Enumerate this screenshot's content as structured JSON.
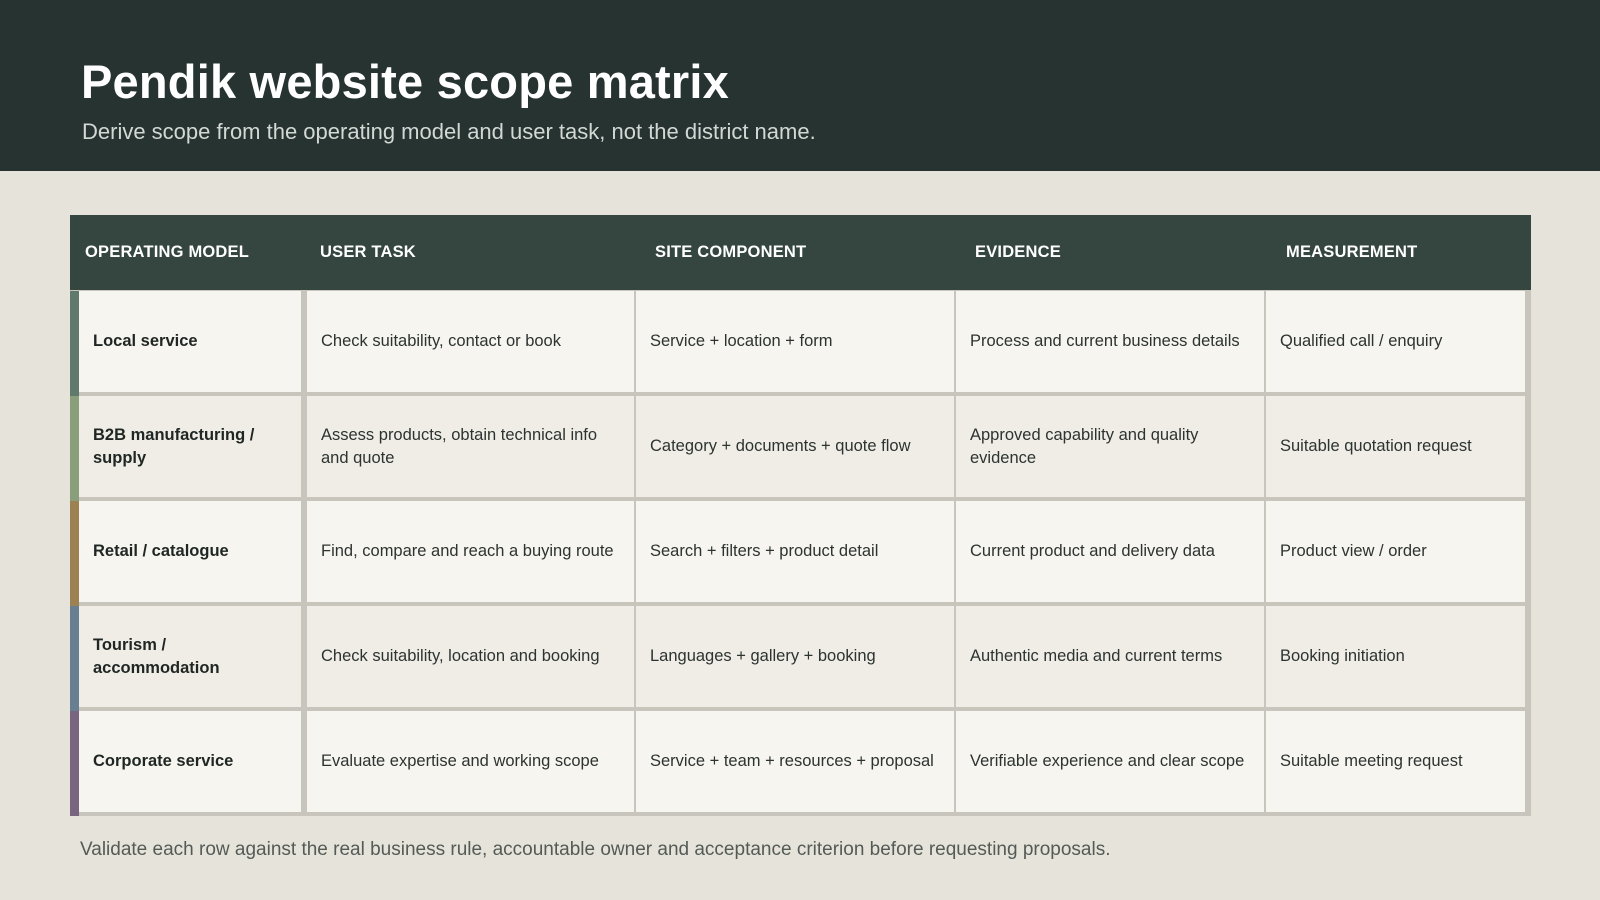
{
  "header": {
    "title": "Pendik website scope matrix",
    "subtitle": "Derive scope from the operating model and user task, not the district name."
  },
  "table": {
    "columns": [
      "OPERATING MODEL",
      "USER TASK",
      "SITE COMPONENT",
      "EVIDENCE",
      "MEASUREMENT"
    ],
    "rows": [
      {
        "accent_color": "#5f7a6c",
        "cells": [
          "Local service",
          "Check suitability, contact or book",
          "Service + location + form",
          "Process and current business details",
          "Qualified call / enquiry"
        ]
      },
      {
        "accent_color": "#8a9e7c",
        "cells": [
          "B2B manufacturing / supply",
          "Assess products, obtain technical info and quote",
          "Category + documents + quote flow",
          "Approved capability and quality evidence",
          "Suitable quotation request"
        ]
      },
      {
        "accent_color": "#9c8152",
        "cells": [
          "Retail / catalogue",
          "Find, compare and reach a buying route",
          "Search + filters + product detail",
          "Current product and delivery data",
          "Product view / order"
        ]
      },
      {
        "accent_color": "#687f92",
        "cells": [
          "Tourism / accommodation",
          "Check suitability, location and booking",
          "Languages + gallery + booking",
          "Authentic media and current terms",
          "Booking initiation"
        ]
      },
      {
        "accent_color": "#7a6580",
        "cells": [
          "Corporate service",
          "Evaluate expertise and working scope",
          "Service + team + resources + proposal",
          "Verifiable experience and clear scope",
          "Suitable meeting request"
        ]
      }
    ]
  },
  "footer": {
    "note": "Validate each row against the real business rule, accountable owner and acceptance criterion before requesting proposals."
  }
}
